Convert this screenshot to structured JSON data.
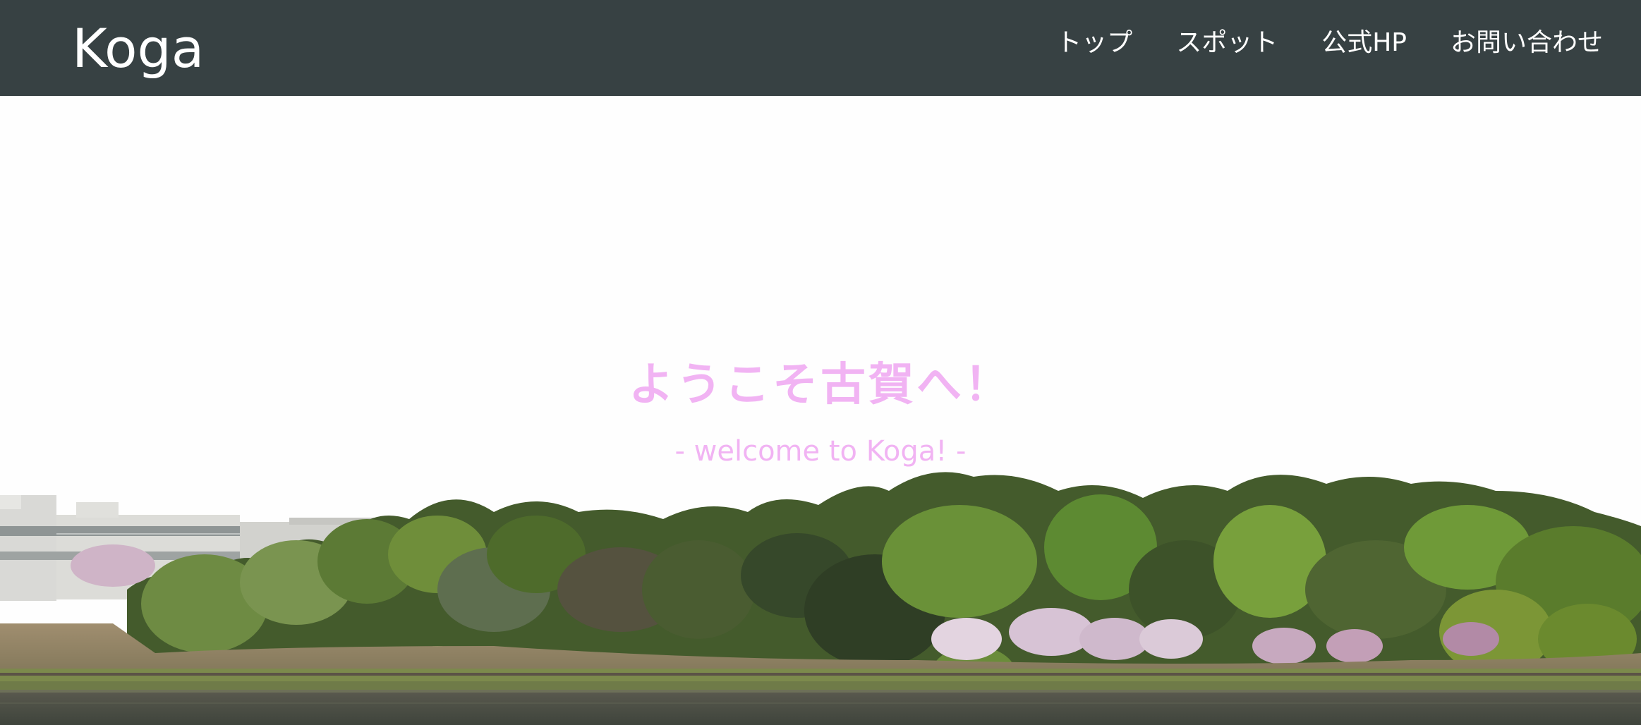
{
  "header": {
    "brand": "Koga",
    "nav": [
      "トップ",
      "スポット",
      "公式HP",
      "お問い合わせ"
    ]
  },
  "hero": {
    "title": "ようこそ古賀へ！",
    "subtitle": "- welcome to Koga! -",
    "text_color": "#f1b3f3"
  },
  "colors": {
    "header_bg": "#374143",
    "header_text": "#ffffff"
  }
}
